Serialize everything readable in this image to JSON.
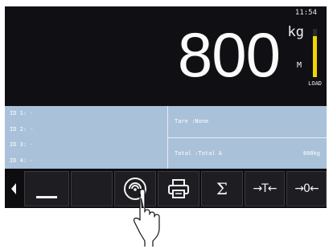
{
  "display": {
    "time": "11:54",
    "weight": "800",
    "unit": "kg",
    "mode": "M",
    "load_label": "LOAD",
    "load_level": 0.85,
    "colors": {
      "load_bar": "#f0d500"
    }
  },
  "ids": [
    "ID 1: -",
    "ID 2: -",
    "ID 3: -",
    "ID 4: -"
  ],
  "tare": "Tare  :None",
  "total": {
    "label": "Total :Total A",
    "value": "800kg"
  },
  "toolbar": {
    "icons": [
      "left-arrow-icon",
      "underscore-icon",
      "wireless-icon",
      "printer-icon",
      "sigma-icon",
      "tare-icon",
      "zero-icon"
    ],
    "sigma": "Σ",
    "tare": "→T←",
    "zero": "→0←"
  },
  "colors": {
    "info_panel": "#a9c1d9",
    "screen": "#101014"
  }
}
